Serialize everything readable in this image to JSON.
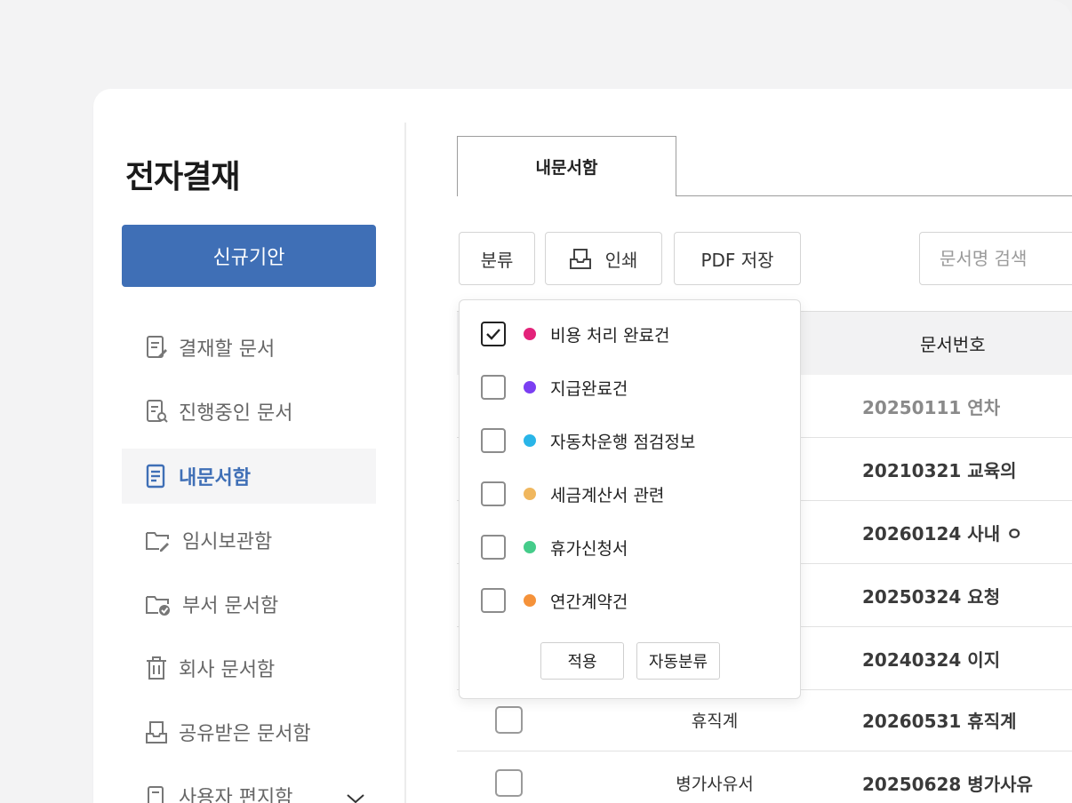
{
  "app": {
    "title": "전자결재"
  },
  "sidebar": {
    "new_button": "신규기안",
    "items": [
      {
        "label": "결재할 문서",
        "icon": "doc-edit-icon"
      },
      {
        "label": "진행중인 문서",
        "icon": "doc-search-icon"
      },
      {
        "label": "내문서함",
        "icon": "doc-icon",
        "active": true
      },
      {
        "label": "임시보관함",
        "icon": "folder-edit-icon"
      },
      {
        "label": "부서 문서함",
        "icon": "folder-check-icon"
      },
      {
        "label": "회사 문서함",
        "icon": "trash-icon"
      },
      {
        "label": "공유받은 문서함",
        "icon": "inbox-icon"
      },
      {
        "label": "사용자 편지함",
        "icon": "doc-icon"
      }
    ]
  },
  "tabs": [
    {
      "label": "내문서함",
      "active": true
    }
  ],
  "toolbar": {
    "classify": "분류",
    "print": "인쇄",
    "pdf": "PDF 저장",
    "search_placeholder": "문서명 검색"
  },
  "table": {
    "header_docno": "문서번호",
    "rows": [
      {
        "category": "",
        "docno": "20250111 연차",
        "dim": true
      },
      {
        "category": "",
        "docno": "20210321 교육의"
      },
      {
        "category": "",
        "docno": "20260124 사내 ㅇ"
      },
      {
        "category": "",
        "docno": "20250324 요청"
      },
      {
        "category": "",
        "docno": "20240324 이지"
      },
      {
        "category": "휴직계",
        "docno": "20260531 휴직계"
      },
      {
        "category": "병가사유서",
        "docno": "20250628 병가사유"
      }
    ]
  },
  "dropdown": {
    "options": [
      {
        "label": "비용 처리 완료건",
        "color": "#e3237a",
        "checked": true
      },
      {
        "label": "지급완료건",
        "color": "#7b3ff2",
        "checked": false
      },
      {
        "label": "자동차운행 점검정보",
        "color": "#29b5e8",
        "checked": false
      },
      {
        "label": "세금계산서 관련",
        "color": "#f0b75e",
        "checked": false
      },
      {
        "label": "휴가신청서",
        "color": "#45cc8a",
        "checked": false
      },
      {
        "label": "연간계약건",
        "color": "#f5923a",
        "checked": false
      }
    ],
    "apply": "적용",
    "auto": "자동분류"
  }
}
